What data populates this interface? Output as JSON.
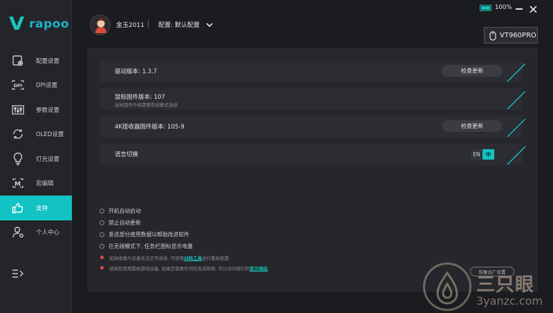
{
  "brand": {
    "mark": "V",
    "name": "rapoo"
  },
  "header": {
    "username": "金玉2011",
    "separator": "|",
    "config_label": "配置: 默认配置",
    "battery_percent": "100%",
    "battery_level": 1.0,
    "device": "VT960PRO"
  },
  "sidebar": {
    "items": [
      {
        "label": "配置设置",
        "icon": "config-icon"
      },
      {
        "label": "DPI设置",
        "icon": "dpi-icon"
      },
      {
        "label": "参数设置",
        "icon": "params-icon"
      },
      {
        "label": "OLED设置",
        "icon": "oled-icon"
      },
      {
        "label": "灯光设置",
        "icon": "bulb-icon"
      },
      {
        "label": "宏编辑",
        "icon": "macro-icon"
      },
      {
        "label": "支持",
        "icon": "thumbs-up-icon",
        "active": true
      },
      {
        "label": "个人中心",
        "icon": "user-icon"
      }
    ]
  },
  "main": {
    "driver": {
      "label": "驱动版本: 1.3.7",
      "button": "检查更新"
    },
    "mouse_fw": {
      "label": "鼠标固件版本: 107",
      "sub": "鼠标固件升级需要有线模式连接"
    },
    "receiver_fw": {
      "label": "4K接收器固件版本: 105-9",
      "button": "检查更新"
    },
    "language": {
      "label": "语言切换",
      "en": "EN",
      "zh": "中"
    },
    "options": [
      "开机自动启动",
      "禁止自动更新",
      "发送部分使用数据以帮助改进软件",
      "在无线模式下, 任务栏图标显示电量"
    ],
    "note1": {
      "before": "如接收器与设备无法正常连接, 可使用",
      "link": "对码工具",
      "after": "进行重新配置"
    },
    "note2": {
      "before": "感谢您使用雷柏游戏设备, 如果您需要任何信息或帮助, 可以访问我们的",
      "link": "官方网站"
    },
    "restore_button": "恢复出厂设置"
  },
  "watermark": {
    "cn": "三只眼",
    "url": "3yanzc.com"
  },
  "colors": {
    "accent": "#13c2c2",
    "background": "#1b1c20",
    "panel": "#25272c",
    "row": "#2b2d33",
    "alert": "#e5484d"
  }
}
